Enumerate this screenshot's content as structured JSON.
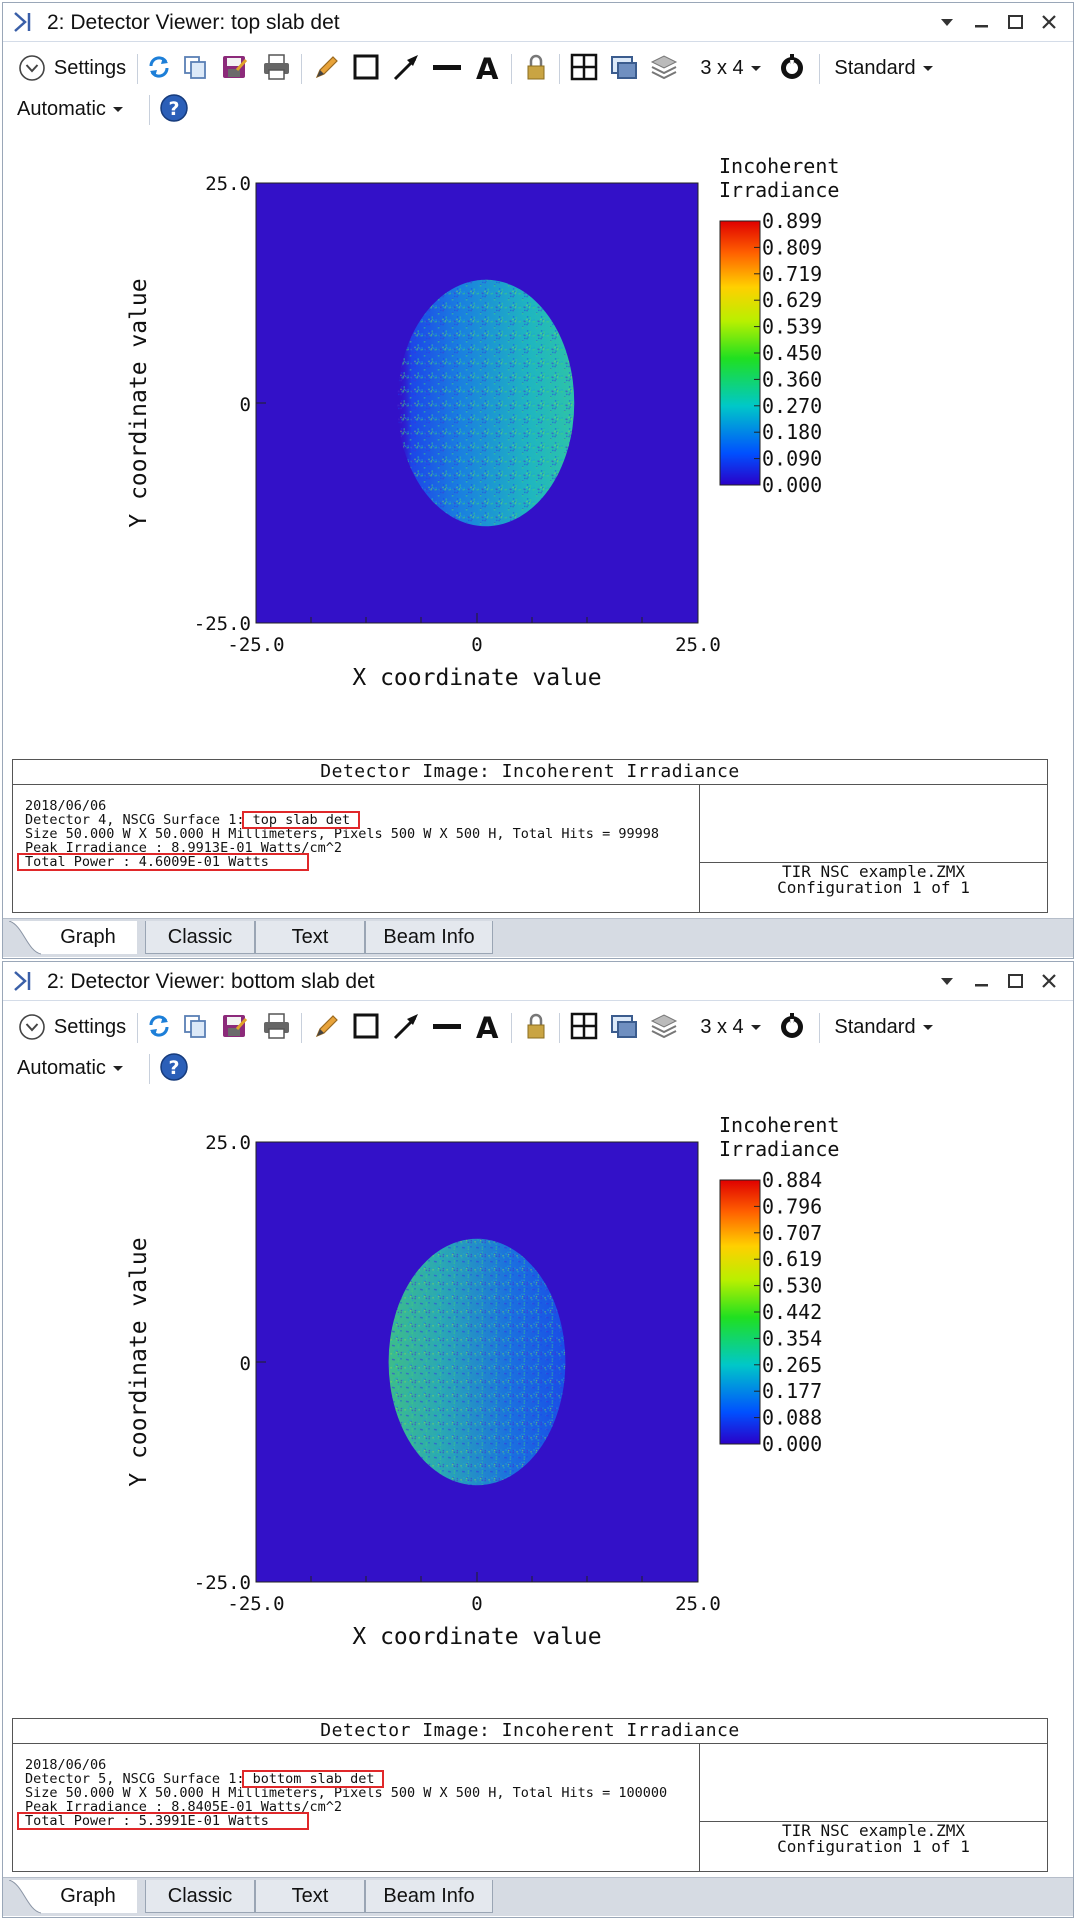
{
  "windows": [
    {
      "title": "2: Detector Viewer: top slab det",
      "toolbar": {
        "settings_label": "Settings",
        "layout_label": "3 x 4",
        "standard_label": "Standard",
        "automatic_label": "Automatic"
      },
      "chart": {
        "x_axis_label": "X coordinate value",
        "y_axis_label": "Y coordinate value",
        "x_ticks": [
          "-25.0",
          "0",
          "25.0"
        ],
        "y_ticks": [
          "25.0",
          "0",
          "-25.0"
        ],
        "colorbar_title_1": "Incoherent",
        "colorbar_title_2": "Irradiance",
        "colorbar_ticks": [
          "0.899",
          "0.809",
          "0.719",
          "0.629",
          "0.539",
          "0.450",
          "0.360",
          "0.270",
          "0.180",
          "0.090",
          "0.000"
        ]
      },
      "info": {
        "title": "Detector Image: Incoherent Irradiance",
        "date": "2018/06/06",
        "detector_line": "Detector 4, NSCG Surface 1: top slab det",
        "size_line": "Size 50.000 W X 50.000 H Millimeters, Pixels 500 W X 500 H, Total Hits = 99998",
        "peak_line": "Peak Irradiance : 8.9913E-01 Watts/cm^2",
        "power_line": "Total Power     : 4.6009E-01 Watts",
        "file_name": "TIR NSC example.ZMX",
        "config": "Configuration 1 of 1"
      },
      "tabs": [
        "Graph",
        "Classic",
        "Text",
        "Beam Info"
      ]
    },
    {
      "title": "2: Detector Viewer: bottom slab det",
      "toolbar": {
        "settings_label": "Settings",
        "layout_label": "3 x 4",
        "standard_label": "Standard",
        "automatic_label": "Automatic"
      },
      "chart": {
        "x_axis_label": "X coordinate value",
        "y_axis_label": "Y coordinate value",
        "x_ticks": [
          "-25.0",
          "0",
          "25.0"
        ],
        "y_ticks": [
          "25.0",
          "0",
          "-25.0"
        ],
        "colorbar_title_1": "Incoherent",
        "colorbar_title_2": "Irradiance",
        "colorbar_ticks": [
          "0.884",
          "0.796",
          "0.707",
          "0.619",
          "0.530",
          "0.442",
          "0.354",
          "0.265",
          "0.177",
          "0.088",
          "0.000"
        ]
      },
      "info": {
        "title": "Detector Image: Incoherent Irradiance",
        "date": "2018/06/06",
        "detector_line": "Detector 5, NSCG Surface 1: bottom slab det",
        "size_line": "Size 50.000 W X 50.000 H Millimeters, Pixels 500 W X 500 H, Total Hits = 100000",
        "peak_line": "Peak Irradiance : 8.8405E-01 Watts/cm^2",
        "power_line": "Total Power     : 5.3991E-01 Watts",
        "file_name": "TIR NSC example.ZMX",
        "config": "Configuration 1 of 1"
      },
      "tabs": [
        "Graph",
        "Classic",
        "Text",
        "Beam Info"
      ]
    }
  ],
  "chart_data": [
    {
      "type": "heatmap",
      "title": "Incoherent Irradiance",
      "xlabel": "X coordinate value",
      "ylabel": "Y coordinate value",
      "xlim": [
        -25.0,
        25.0
      ],
      "ylim": [
        -25.0,
        25.0
      ],
      "colorbar_range": [
        0.0,
        0.899
      ],
      "spot": {
        "shape": "ellipse",
        "center": [
          1.0,
          0.0
        ],
        "semi_axes": [
          10.0,
          14.0
        ],
        "brighter_side": "right"
      }
    },
    {
      "type": "heatmap",
      "title": "Incoherent Irradiance",
      "xlabel": "X coordinate value",
      "ylabel": "Y coordinate value",
      "xlim": [
        -25.0,
        25.0
      ],
      "ylim": [
        -25.0,
        25.0
      ],
      "colorbar_range": [
        0.0,
        0.884
      ],
      "spot": {
        "shape": "ellipse",
        "center": [
          0.0,
          0.0
        ],
        "semi_axes": [
          10.0,
          14.0
        ],
        "brighter_side": "left"
      }
    }
  ],
  "colors": {
    "background_blue": "#3311c8",
    "highlight_red": "#e0282a",
    "tab_bar": "#d6dbe3"
  }
}
